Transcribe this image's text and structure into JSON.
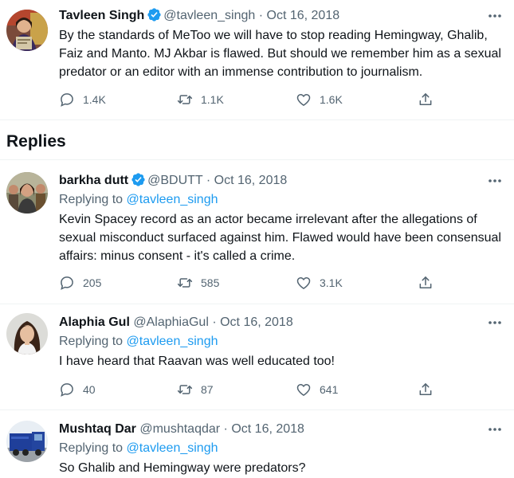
{
  "main_tweet": {
    "name": "Tavleen Singh",
    "handle": "@tavleen_singh",
    "date": "Oct 16, 2018",
    "text": "By the standards of MeToo we will have to stop reading Hemingway, Ghalib, Faiz and Manto. MJ Akbar is flawed. But should we remember him as a sexual predator or an editor with an immense contribution to journalism.",
    "replies": "1.4K",
    "retweets": "1.1K",
    "likes": "1.6K"
  },
  "replies_heading": "Replies",
  "replying_to_label": "Replying to",
  "separator": "·",
  "replies": [
    {
      "name": "barkha dutt",
      "verified": true,
      "handle": "@BDUTT",
      "date": "Oct 16, 2018",
      "replying_to": "@tavleen_singh",
      "text": "Kevin Spacey record as an actor became irrelevant after the allegations of sexual misconduct surfaced against him. Flawed would have been consensual affairs: minus consent - it's called a crime.",
      "replies": "205",
      "retweets": "585",
      "likes": "3.1K"
    },
    {
      "name": "Alaphia Gul",
      "verified": false,
      "handle": "@AlaphiaGul",
      "date": "Oct 16, 2018",
      "replying_to": "@tavleen_singh",
      "text": "I have heard that Raavan was well educated too!",
      "replies": "40",
      "retweets": "87",
      "likes": "641"
    },
    {
      "name": "Mushtaq Dar",
      "verified": false,
      "handle": "@mushtaqdar",
      "date": "Oct 16, 2018",
      "replying_to": "@tavleen_singh",
      "text": "So Ghalib and Hemingway were predators?"
    }
  ],
  "colors": {
    "text_primary": "#0f1419",
    "text_secondary": "#536471",
    "accent": "#1d9bf0",
    "divider": "#eff3f4"
  },
  "icons": [
    "verified-badge-icon",
    "more-options-icon",
    "reply-icon",
    "retweet-icon",
    "like-icon",
    "share-icon"
  ]
}
